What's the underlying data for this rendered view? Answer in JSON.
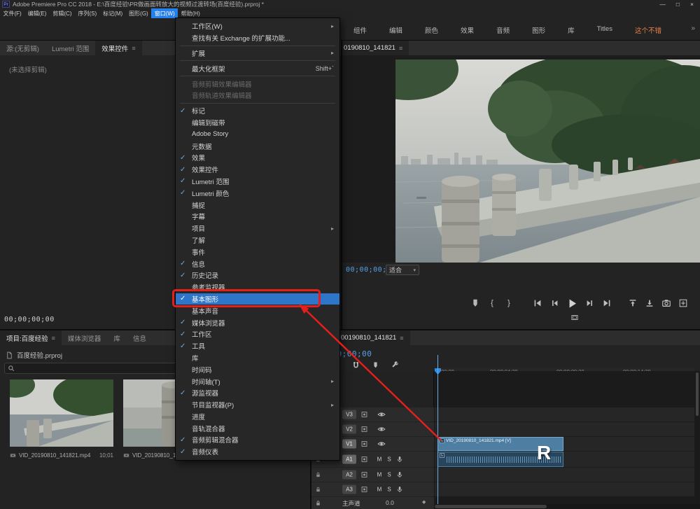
{
  "window": {
    "app_badge": "Pr",
    "title": "Adobe Premiere Pro CC 2018 - E:\\百度经验\\PR做画面转放大的视频过渡转场(百度经验).prproj *",
    "controls": {
      "minimize": "—",
      "maximize": "□",
      "close": "×"
    }
  },
  "menubar": {
    "items": [
      {
        "label": "文件(F)"
      },
      {
        "label": "编辑(E)"
      },
      {
        "label": "剪辑(C)"
      },
      {
        "label": "序列(S)"
      },
      {
        "label": "标记(M)"
      },
      {
        "label": "图形(G)"
      },
      {
        "label": "窗口(W)",
        "active": true
      },
      {
        "label": "帮助(H)"
      }
    ]
  },
  "window_menu": {
    "items": [
      {
        "label": "工作区(W)",
        "submenu": true
      },
      {
        "label": "查找有关 Exchange 的扩展功能..."
      },
      {
        "sep": true
      },
      {
        "label": "扩展",
        "submenu": true
      },
      {
        "sep": true
      },
      {
        "label": "最大化框架",
        "shortcut": "Shift+`"
      },
      {
        "sep": true
      },
      {
        "label": "音频剪辑效果编辑器",
        "disabled": true
      },
      {
        "label": "音频轨道效果编辑器",
        "disabled": true
      },
      {
        "sep": true
      },
      {
        "label": "标记",
        "checked": true
      },
      {
        "label": "编辑到磁带"
      },
      {
        "label": "Adobe Story"
      },
      {
        "label": "元数据"
      },
      {
        "label": "效果",
        "checked": true
      },
      {
        "label": "效果控件",
        "checked": true
      },
      {
        "label": "Lumetri 范围",
        "checked": true
      },
      {
        "label": "Lumetri 颜色",
        "checked": true
      },
      {
        "label": "捕捉"
      },
      {
        "label": "字幕"
      },
      {
        "label": "项目",
        "submenu": true
      },
      {
        "label": "了解"
      },
      {
        "label": "事件"
      },
      {
        "label": "信息",
        "checked": true
      },
      {
        "label": "历史记录",
        "checked": true
      },
      {
        "label": "参考监视器"
      },
      {
        "label": "基本图形",
        "checked": true,
        "highlighted": true
      },
      {
        "label": "基本声音"
      },
      {
        "label": "媒体浏览器",
        "checked": true
      },
      {
        "label": "工作区",
        "checked": true
      },
      {
        "label": "工具",
        "checked": true
      },
      {
        "label": "库"
      },
      {
        "label": "时间码"
      },
      {
        "label": "时间轴(T)",
        "submenu": true
      },
      {
        "label": "源监视器",
        "checked": true
      },
      {
        "label": "节目监视器(P)",
        "submenu": true
      },
      {
        "label": "进度"
      },
      {
        "label": "音轨混合器"
      },
      {
        "label": "音频剪辑混合器",
        "checked": true
      },
      {
        "label": "音频仪表",
        "checked": true
      }
    ]
  },
  "workspace_tabs": {
    "items": [
      {
        "label": "组件"
      },
      {
        "label": "编辑"
      },
      {
        "label": "颜色"
      },
      {
        "label": "效果"
      },
      {
        "label": "音频"
      },
      {
        "label": "图形"
      },
      {
        "label": "库"
      },
      {
        "label": "Titles"
      },
      {
        "label": "这个不错",
        "active": true
      }
    ],
    "overflow": "»"
  },
  "source_panel": {
    "tabs": [
      {
        "label": "源:(无剪辑)"
      },
      {
        "label": "Lumetri 范围"
      },
      {
        "label": "效果控件",
        "active": true
      }
    ],
    "empty_message": "(未选择剪辑)",
    "timecode": "00;00;00;00"
  },
  "program_monitor": {
    "tab": "0190810_141821",
    "timecode": "00;00;00;00",
    "zoom_level": "适合",
    "transport": {
      "left": [
        {
          "name": "add-marker-button",
          "icon": "marker-icon"
        },
        {
          "name": "mark-in-button",
          "glyph": "{"
        },
        {
          "name": "mark-out-button",
          "glyph": "}"
        }
      ],
      "center": [
        {
          "name": "go-to-in-button",
          "icon": "goto-in-icon"
        },
        {
          "name": "step-back-button",
          "icon": "step-back-icon"
        },
        {
          "name": "play-button",
          "icon": "play-icon"
        },
        {
          "name": "step-forward-button",
          "icon": "step-forward-icon"
        },
        {
          "name": "go-to-out-button",
          "icon": "goto-out-icon"
        }
      ],
      "right": [
        {
          "name": "lift-button",
          "icon": "lift-icon"
        },
        {
          "name": "extract-button",
          "icon": "extract-icon"
        },
        {
          "name": "export-frame-button",
          "icon": "camera-icon"
        },
        {
          "name": "button-editor-button",
          "icon": "grid-icon"
        }
      ]
    }
  },
  "project_panel": {
    "tabs": [
      {
        "label": "项目:百度经验",
        "active": true
      },
      {
        "label": "媒体浏览器"
      },
      {
        "label": "库"
      },
      {
        "label": "信息"
      }
    ],
    "project_file": "百度经验.prproj",
    "search_placeholder": "",
    "items": [
      {
        "name": "VID_20190810_141821.mp4",
        "duration": "10;01"
      },
      {
        "name": "VID_20190810_1...",
        "duration": ""
      }
    ]
  },
  "timeline": {
    "tab": "00190810_141821",
    "timecode": "00;00;00;00",
    "tools": [
      {
        "name": "snap-toggle",
        "icon": "magnet-icon"
      },
      {
        "name": "add-marker-button",
        "icon": "marker-icon"
      },
      {
        "name": "timeline-settings-button",
        "icon": "wrench-icon"
      }
    ],
    "ruler_labels": [
      ";00;00",
      "00;00;04;29",
      "00;00;09;29",
      "00;00;14;29"
    ],
    "video_tracks": [
      {
        "label": "V3"
      },
      {
        "label": "V2"
      },
      {
        "label": "V1",
        "targeted": true
      }
    ],
    "audio_tracks": [
      {
        "label": "A1",
        "targeted": true
      },
      {
        "label": "A2"
      },
      {
        "label": "A3"
      }
    ],
    "audio_buttons": {
      "mute": "M",
      "solo": "S"
    },
    "master": {
      "label": "主声道",
      "level": "0.0"
    },
    "video_clip_label": "VID_20190810_141821.mp4 [V]",
    "watermark": "R"
  },
  "colors": {
    "accent_blue": "#2e76c9",
    "timecode_blue": "#56a0e6",
    "workspace_active_orange": "#e8834a",
    "render_bar_yellow": "#c9a91e",
    "annotation_red": "#e3201b"
  }
}
